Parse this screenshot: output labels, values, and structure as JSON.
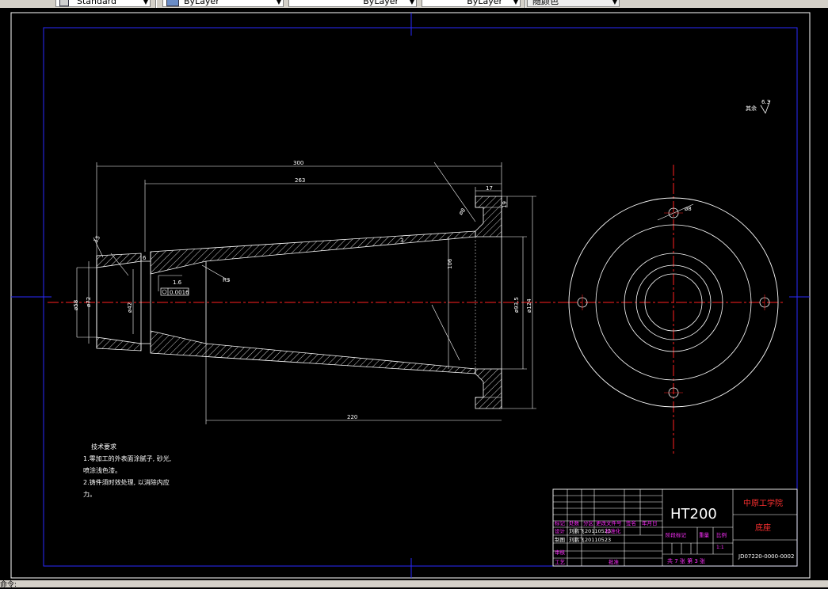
{
  "toolbar": {
    "text_style": "Standard",
    "layer": "ByLayer",
    "linetype": "ByLayer",
    "lineweight": "ByLayer",
    "plot_style": "随颜色"
  },
  "status": {
    "text": "命令:"
  },
  "colors": {
    "background": "#000000",
    "lines": "#ffffff",
    "centerline": "#ff0000",
    "frame": "#0000ff",
    "title_text": "#ff00ff"
  },
  "drawing": {
    "dims": {
      "d300": "300",
      "d263": "263",
      "d220": "220",
      "d17": "17",
      "d19": "19",
      "d106": "106",
      "phi124": "ø124",
      "phi93": "ø93.5",
      "phi58": "ø58",
      "phi72": "ø72",
      "phi42": "ø42",
      "phi8": "ø8",
      "d6": "6",
      "r3": "R3",
      "d3": "3",
      "c15": "15"
    },
    "tolerance": {
      "ref": "1.6",
      "value": "0.0016"
    },
    "roughness": {
      "label": "其余",
      "value": "6.3"
    }
  },
  "tech_req": {
    "title": "技术要求",
    "lines": [
      "1.零加工的外表面涂腻子, 砂光,",
      "喷涂浅色漆。",
      "2.铸件须时效处理, 以消除内应",
      "力。"
    ]
  },
  "title_block": {
    "material": "HT200",
    "school": "中原工学院",
    "part_name": "底座",
    "drawing_no": "JD07220-0000-0002",
    "scale": "1:1",
    "sheet": "共 7 张 第 3 张",
    "header_labels": [
      "标记",
      "处数",
      "分区",
      "更改文件号",
      "签名",
      "年月日"
    ],
    "rows": [
      {
        "label": "设计",
        "name": "刘鹏飞",
        "date": "20110523",
        "extra": "标准化"
      },
      {
        "label": "制图",
        "name": "刘鹏飞",
        "date": "20110523",
        "extra": ""
      },
      {
        "label": "审核",
        "name": "",
        "date": "",
        "extra": ""
      },
      {
        "label": "工艺",
        "name": "",
        "date": "",
        "extra": "批准"
      }
    ],
    "stage_labels": [
      "阶段标记",
      "重量",
      "比例"
    ]
  }
}
